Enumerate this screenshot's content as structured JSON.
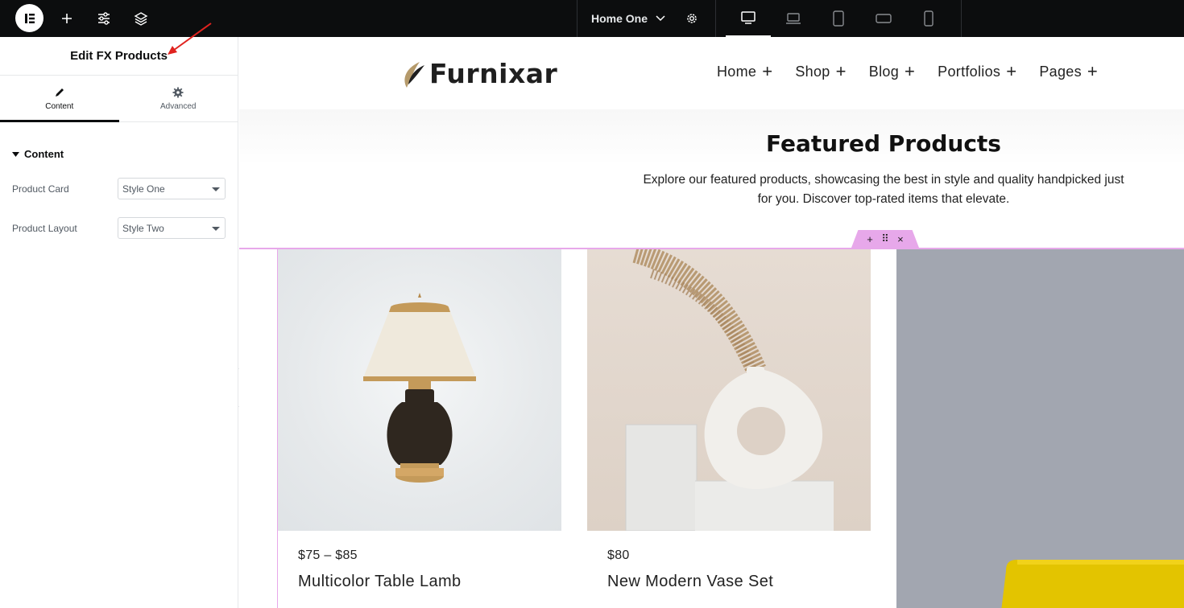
{
  "editor": {
    "topbar": {
      "page_name": "Home One"
    },
    "panel": {
      "title": "Edit FX Products",
      "tabs": [
        {
          "label": "Content"
        },
        {
          "label": "Advanced"
        }
      ],
      "section_title": "Content",
      "controls": [
        {
          "label": "Product Card",
          "value": "Style One"
        },
        {
          "label": "Product Layout",
          "value": "Style Two"
        }
      ]
    }
  },
  "site": {
    "brand": "Furnixar",
    "nav": [
      {
        "label": "Home"
      },
      {
        "label": "Shop"
      },
      {
        "label": "Blog"
      },
      {
        "label": "Portfolios"
      },
      {
        "label": "Pages"
      }
    ],
    "featured": {
      "title": "Featured Products",
      "description": "Explore our featured products, showcasing the best in style and quality handpicked just for you. Discover top-rated items that elevate."
    },
    "products": [
      {
        "price": "$75  –  $85",
        "name": "Multicolor Table Lamb"
      },
      {
        "price": "$80",
        "name": "New Modern Vase Set"
      }
    ]
  },
  "colors": {
    "topbar_bg": "#0c0d0e",
    "section_outline": "#e7a8ea",
    "arrow_red": "#e0231f",
    "brand_accent": "#b59a6b"
  }
}
